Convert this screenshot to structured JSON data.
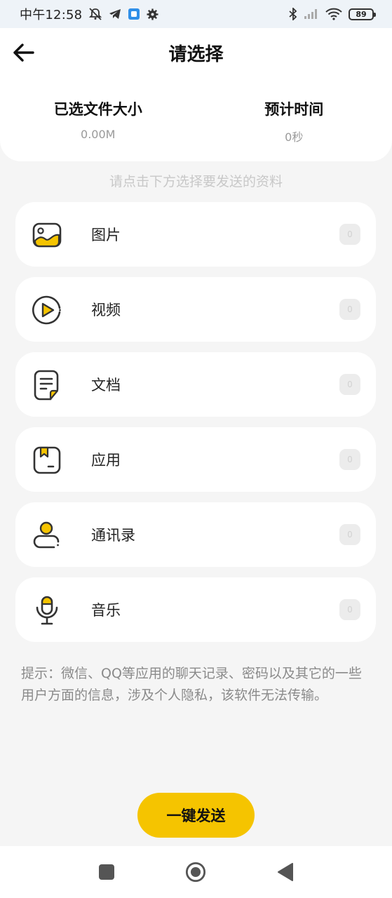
{
  "status_bar": {
    "time": "中午12:58",
    "battery": "89",
    "icons": [
      "mute-bell-icon",
      "telegram-icon",
      "app-notification-icon",
      "settings-gear-icon",
      "bluetooth-icon",
      "signal-icon",
      "wifi-icon",
      "battery-icon"
    ]
  },
  "header": {
    "title": "请选择",
    "back_icon": "arrow-left-icon"
  },
  "summary": {
    "size_label": "已选文件大小",
    "size_value": "0.00M",
    "time_label": "预计时间",
    "time_value": "0秒"
  },
  "hint": "请点击下方选择要发送的资料",
  "categories": [
    {
      "label": "图片",
      "count": "0",
      "icon": "image-icon"
    },
    {
      "label": "视频",
      "count": "0",
      "icon": "video-play-icon"
    },
    {
      "label": "文档",
      "count": "0",
      "icon": "document-icon"
    },
    {
      "label": "应用",
      "count": "0",
      "icon": "app-box-icon"
    },
    {
      "label": "通讯录",
      "count": "0",
      "icon": "contact-icon"
    },
    {
      "label": "音乐",
      "count": "0",
      "icon": "microphone-icon"
    }
  ],
  "note": "提示：微信、QQ等应用的聊天记录、密码以及其它的一些用户方面的信息，涉及个人隐私，该软件无法传输。",
  "send_button": "一键发送",
  "colors": {
    "accent": "#f5c400",
    "background": "#f5f5f5",
    "card": "#ffffff",
    "icon_stroke": "#333333"
  },
  "nav_bar": [
    "recents-square-icon",
    "home-circle-icon",
    "back-triangle-icon"
  ]
}
